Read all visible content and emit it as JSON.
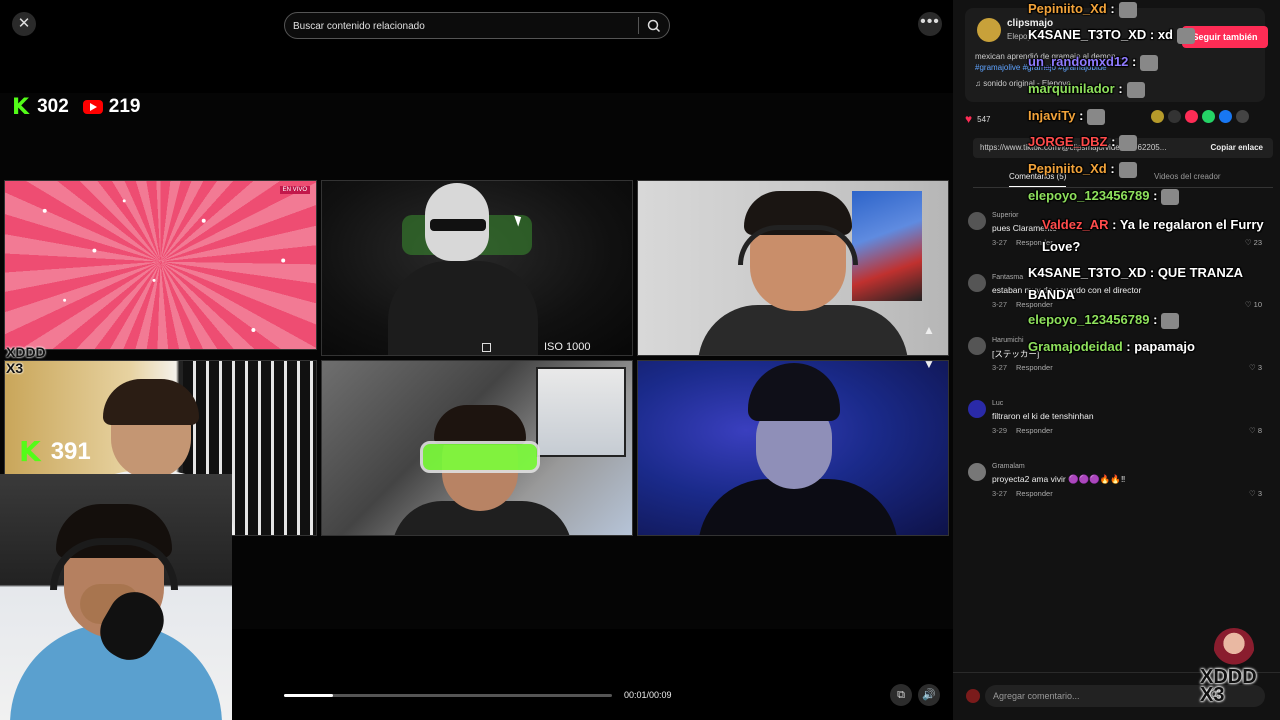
{
  "search": {
    "placeholder": "Buscar contenido relacionado"
  },
  "counters": {
    "kick_count": "302",
    "youtube_count": "219",
    "kick_logo": "K",
    "kick_count_2": "391"
  },
  "tiles": {
    "live_badge": "EN VIVO",
    "iso_label": "ISO 1000"
  },
  "overlay_text": {
    "xddd": "XDDD",
    "x3": "X3"
  },
  "player": {
    "time": "00:01/00:09",
    "progress": 0.15
  },
  "creator": {
    "name": "clipsmajo",
    "subtitle": "Elepoyo",
    "follow_label": "Seguir también",
    "description": "mexican aprendió de gramajo al demon...",
    "tags": "#gramajolive #gramajo #gramajoblue",
    "sound": "sonido original - Elepoyo",
    "likes": "547"
  },
  "share": {
    "url": "https://www.tiktok.com/@clipsmajo/video/...762205...",
    "copy_label": "Copiar enlace"
  },
  "tabs": [
    {
      "label": "Comentarios (5)"
    },
    {
      "label": "Videos del creador"
    }
  ],
  "comments": [
    {
      "user": "Superior",
      "text": "pues Claramente",
      "date": "3-27",
      "reply": "Responder",
      "likes": "23"
    },
    {
      "user": "Fantasma",
      "text": "estaban muy de acuerdo con el director",
      "date": "3-27",
      "reply": "Responder",
      "likes": "10"
    },
    {
      "user": "Harumichi",
      "text": "[ステッカー]",
      "date": "3-27",
      "reply": "Responder",
      "likes": "3"
    },
    {
      "user": "Luc",
      "text": "filtraron el ki de tenshinhan",
      "date": "3-29",
      "reply": "Responder",
      "likes": "8"
    },
    {
      "user": "Gramalam",
      "text": "proyecta2 ama vivir 🟣🟣🟣🔥🔥‼",
      "date": "3-27",
      "reply": "Responder",
      "likes": "3"
    }
  ],
  "comment_input": {
    "placeholder": "Agregar comentario...",
    "at": "@"
  },
  "chat": [
    {
      "user": "Pepiniito_Xd",
      "text": ":",
      "color": "#f2a33a"
    },
    {
      "user": "K4SANE_T3TO_XD",
      "text": ": xd",
      "color": "#ffffff"
    },
    {
      "user": "un_randomxd12",
      "text": ":",
      "color": "#8f7bff"
    },
    {
      "user": "marquinilador",
      "text": ":",
      "color": "#8ee05c"
    },
    {
      "user": "InjaviTy",
      "text": ":",
      "color": "#f2a33a"
    },
    {
      "user": "JORGE_DBZ",
      "text": ":",
      "color": "#ff4b4b"
    },
    {
      "user": "Pepiniito_Xd",
      "text": ":",
      "color": "#f2a33a"
    },
    {
      "user": "elepoyo_123456789",
      "text": ":",
      "color": "#8ee05c"
    },
    {
      "user": "Valdez_AR",
      "text": ": Ya le regalaron el Furry Love?",
      "color": "#ff4b4b"
    },
    {
      "user": "K4SANE_T3TO_XD",
      "text": ": QUE TRANZA BANDA",
      "color": "#ffffff"
    },
    {
      "user": "elepoyo_123456789",
      "text": ":",
      "color": "#8ee05c"
    },
    {
      "user": "Gramajodeidad",
      "text": ": papamajo",
      "color": "#8ee05c"
    }
  ],
  "colors": {
    "kick_green": "#53fc18",
    "youtube_red": "#ff0000",
    "tiktok_pink": "#fe2c55"
  },
  "icons": {
    "close": "close-icon",
    "search": "search-icon",
    "more": "more-icon",
    "pip": "picture-in-picture-icon",
    "volume": "volume-icon",
    "heart": "heart-icon"
  }
}
